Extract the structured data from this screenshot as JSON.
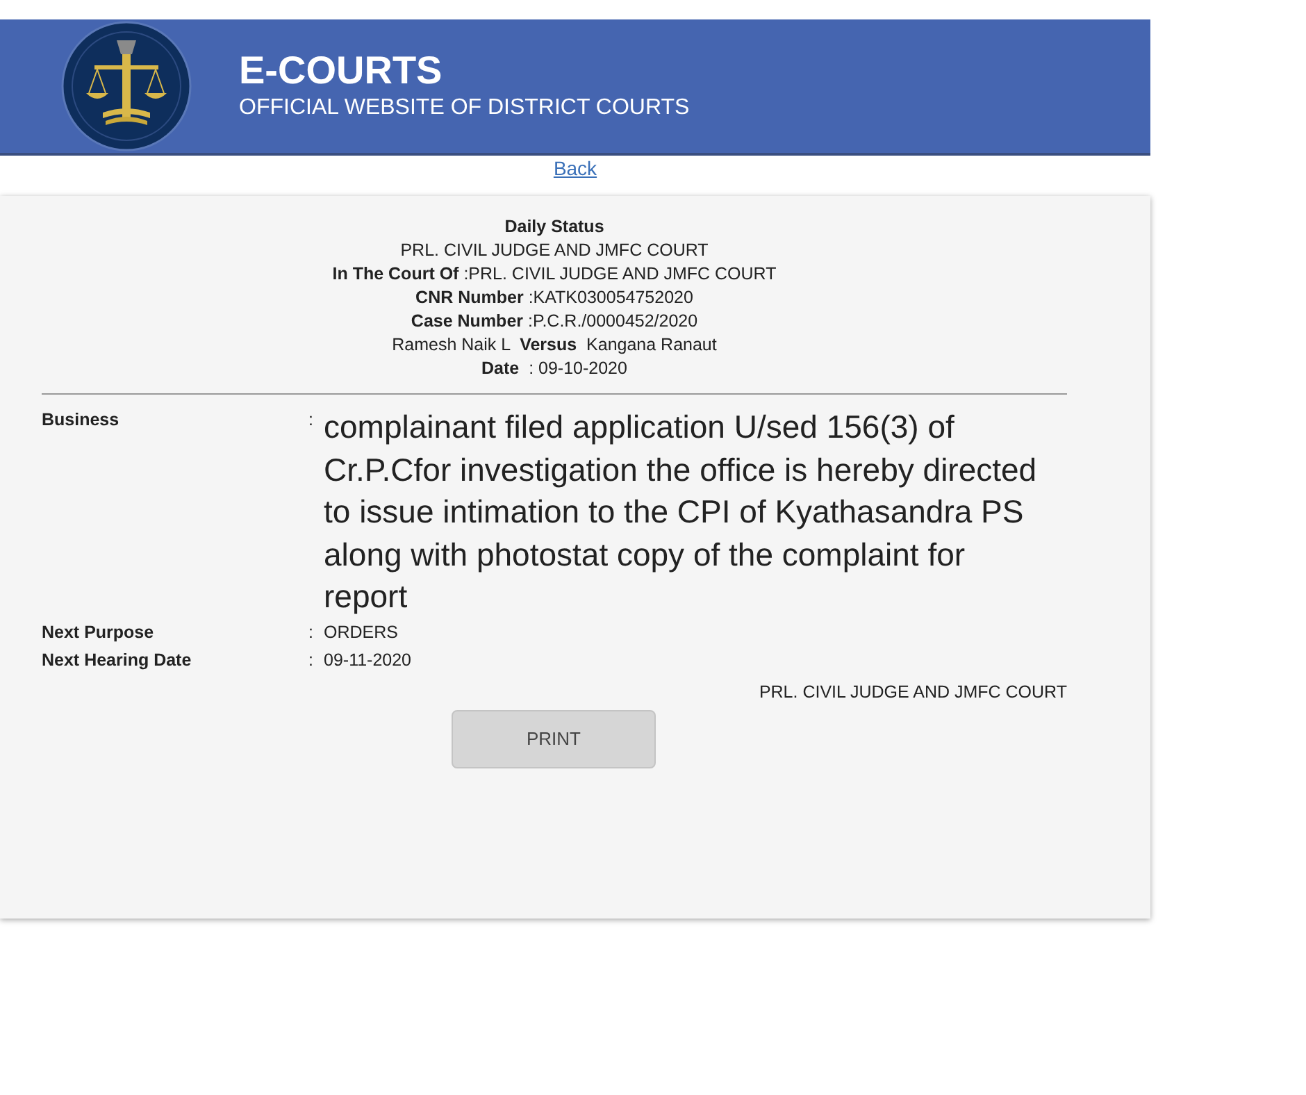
{
  "header": {
    "title": "E-COURTS",
    "subtitle": "OFFICIAL WEBSITE OF DISTRICT COURTS"
  },
  "back_link": "Back",
  "status": {
    "heading": "Daily Status",
    "lines": [
      "PRL. CIVIL JUDGE AND JMFC COURT",
      "**In The Court Of** :PRL. CIVIL JUDGE AND JMFC COURT",
      "**CNR Number** :KATK030054752020",
      "**Case Number** :P.C.R./0000452/2020",
      "Ramesh Naik L  **Versus**  Kangana Ranaut",
      "**Date**  : 09-10-2020"
    ]
  },
  "fields": [
    {
      "label": "Business",
      "separator": ":",
      "value": "complainant filed application U/sed 156(3) of Cr.P.Cfor investigation the office is hereby directed to issue intimation to the CPI of Kyathasandra PS along with photostat copy of the complaint for report",
      "kind": "large"
    },
    {
      "label": "Next Purpose",
      "separator": ":",
      "value": "ORDERS",
      "kind": "normal"
    },
    {
      "label": "Next Hearing Date",
      "separator": ":",
      "value": "09-11-2020",
      "kind": "normal"
    }
  ],
  "signature": "PRL. CIVIL JUDGE AND JMFC COURT",
  "print_button": "PRINT"
}
